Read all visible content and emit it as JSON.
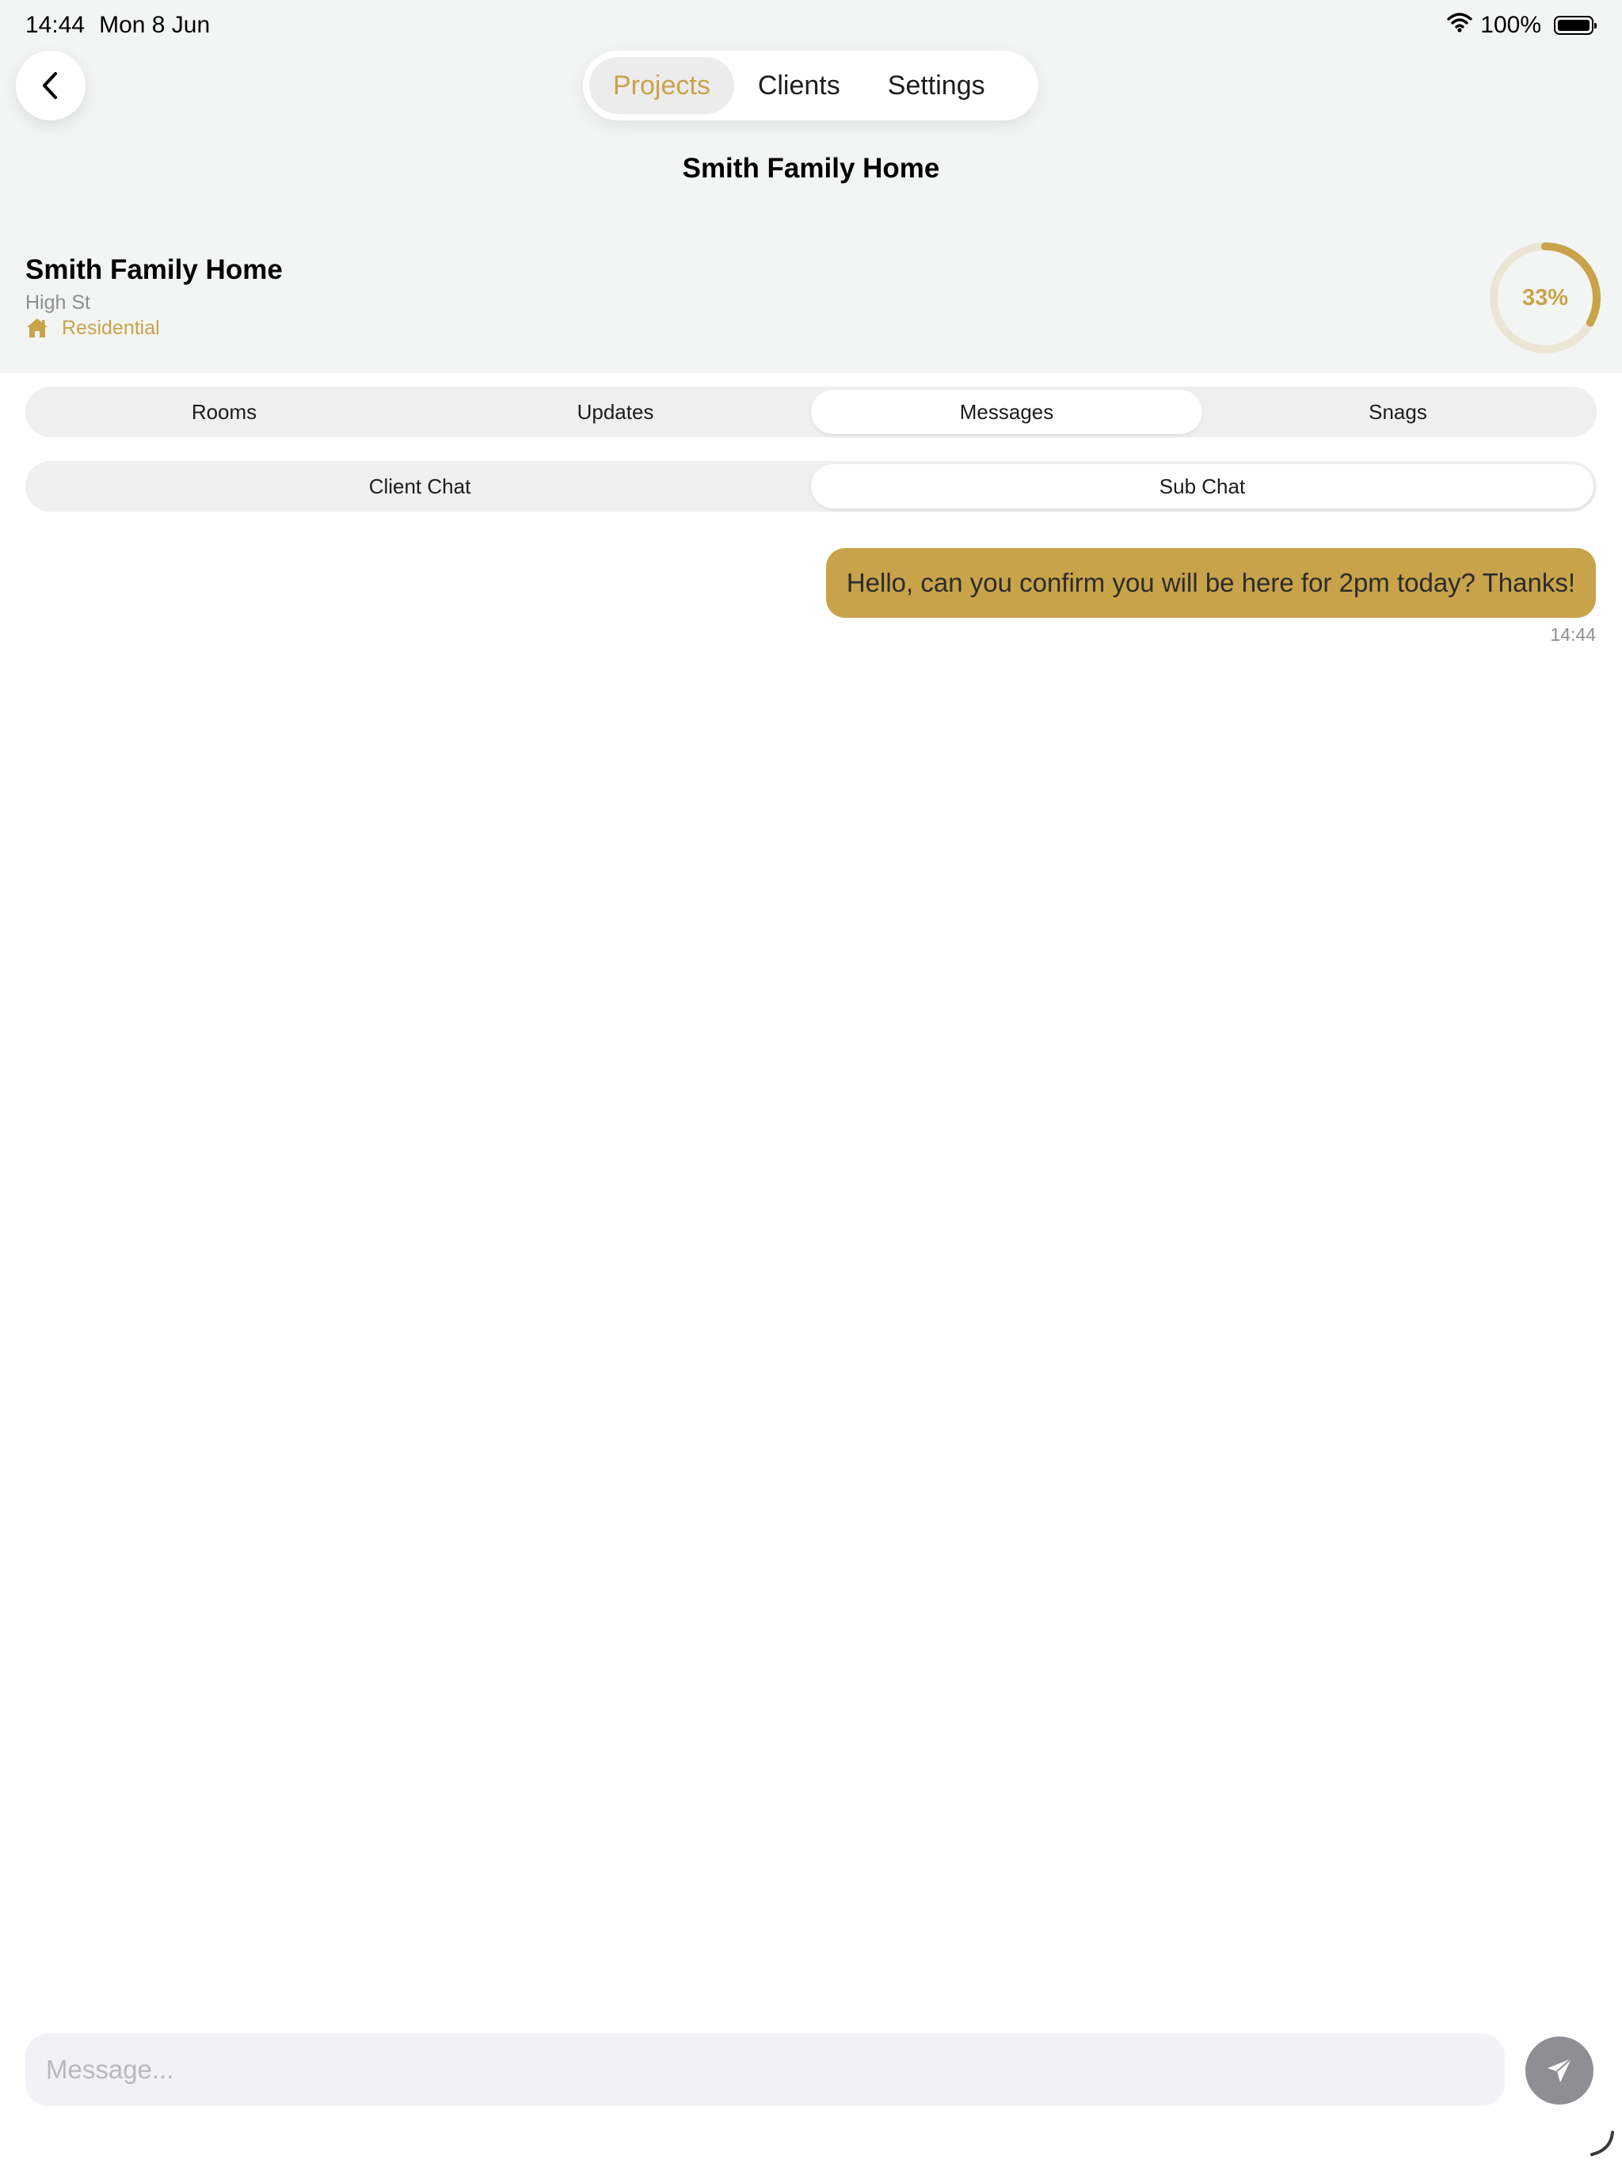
{
  "status_bar": {
    "time": "14:44",
    "date": "Mon 8 Jun",
    "battery": "100%"
  },
  "nav": {
    "items": [
      {
        "label": "Projects",
        "active": true
      },
      {
        "label": "Clients",
        "active": false
      },
      {
        "label": "Settings",
        "active": false
      }
    ]
  },
  "page": {
    "title": "Smith Family Home"
  },
  "project": {
    "name": "Smith Family Home",
    "address": "High St",
    "type": "Residential",
    "progress_label": "33%",
    "progress": 0.33,
    "accent": "#c8a34a"
  },
  "tabs": {
    "items": [
      {
        "label": "Rooms",
        "active": false
      },
      {
        "label": "Updates",
        "active": false
      },
      {
        "label": "Messages",
        "active": true
      },
      {
        "label": "Snags",
        "active": false
      }
    ]
  },
  "chat_tabs": {
    "items": [
      {
        "label": "Client Chat",
        "active": false
      },
      {
        "label": "Sub Chat",
        "active": true
      }
    ]
  },
  "messages": [
    {
      "text": "Hello, can you confirm you will be here for 2pm today? Thanks!",
      "time": "14:44",
      "outgoing": true
    }
  ],
  "composer": {
    "placeholder": "Message...",
    "value": ""
  }
}
